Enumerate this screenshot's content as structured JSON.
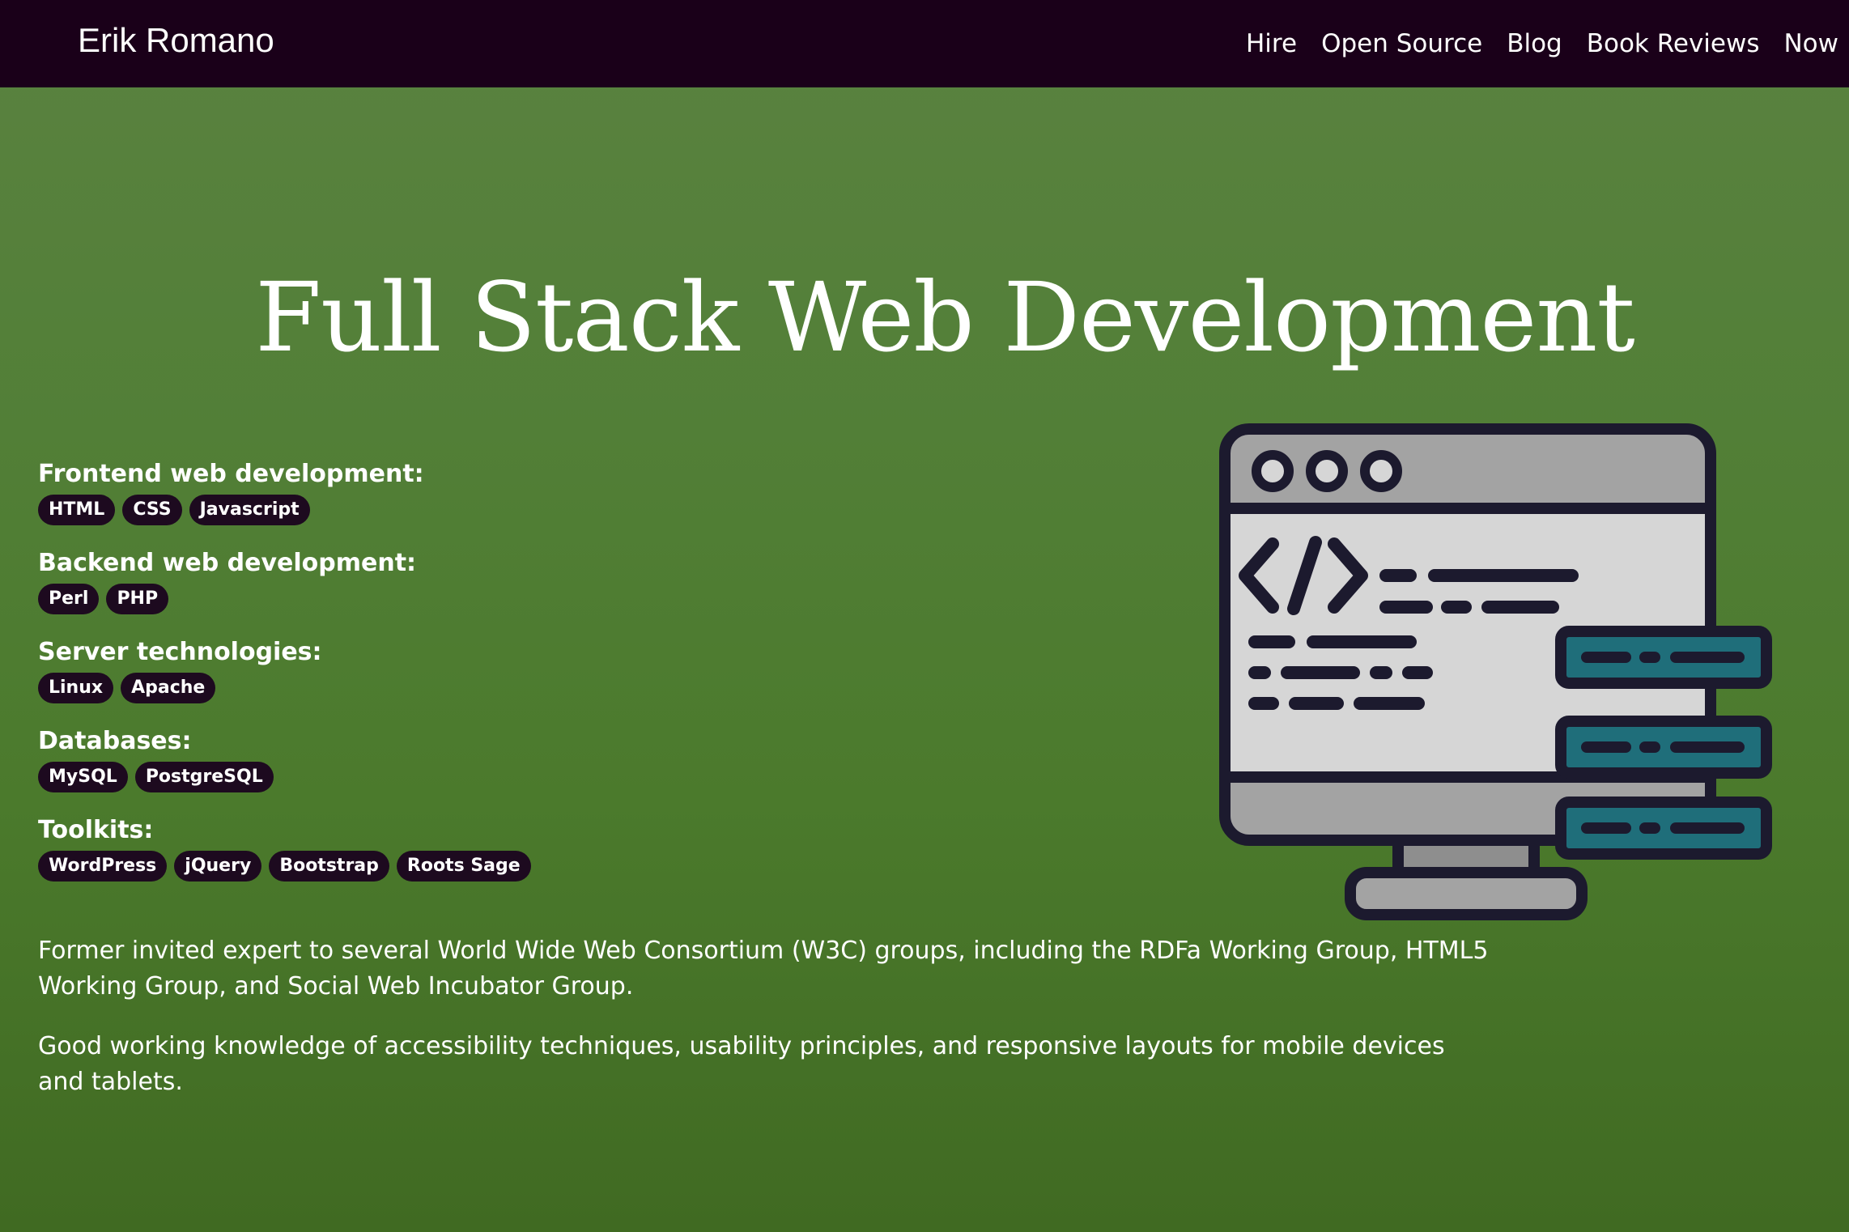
{
  "site": {
    "brand": "Erik Romano"
  },
  "nav": [
    {
      "label": "Hire"
    },
    {
      "label": "Open Source"
    },
    {
      "label": "Blog"
    },
    {
      "label": "Book Reviews"
    },
    {
      "label": "Now"
    }
  ],
  "hero": {
    "title": "Full Stack Web Development"
  },
  "skill_groups": [
    {
      "heading": "Frontend web development:",
      "tags": [
        "HTML",
        "CSS",
        "Javascript"
      ]
    },
    {
      "heading": "Backend web development:",
      "tags": [
        "Perl",
        "PHP"
      ]
    },
    {
      "heading": "Server technologies:",
      "tags": [
        "Linux",
        "Apache"
      ]
    },
    {
      "heading": "Databases:",
      "tags": [
        "MySQL",
        "PostgreSQL"
      ]
    },
    {
      "heading": "Toolkits:",
      "tags": [
        "WordPress",
        "jQuery",
        "Bootstrap",
        "Roots Sage"
      ]
    }
  ],
  "paragraphs": [
    "Former invited expert to several World Wide Web Consortium (W3C) groups, including the RDFa Working Group, HTML5 Working Group, and Social Web Incubator Group.",
    "Good working knowledge of accessibility techniques, usability principles, and responsive layouts for mobile devices and tablets."
  ],
  "illustration": {
    "icon": "code-monitor-icon",
    "code_glyph": "</>"
  },
  "colors": {
    "navbar_bg": "#1a0019",
    "page_bg": "#527f37",
    "tag_bg": "#1d0a1f",
    "illustration_outline": "#1c1a2e",
    "illustration_teal": "#1f6e7a",
    "illustration_gray": "#9a9a9a",
    "illustration_light": "#d6d6d6"
  }
}
